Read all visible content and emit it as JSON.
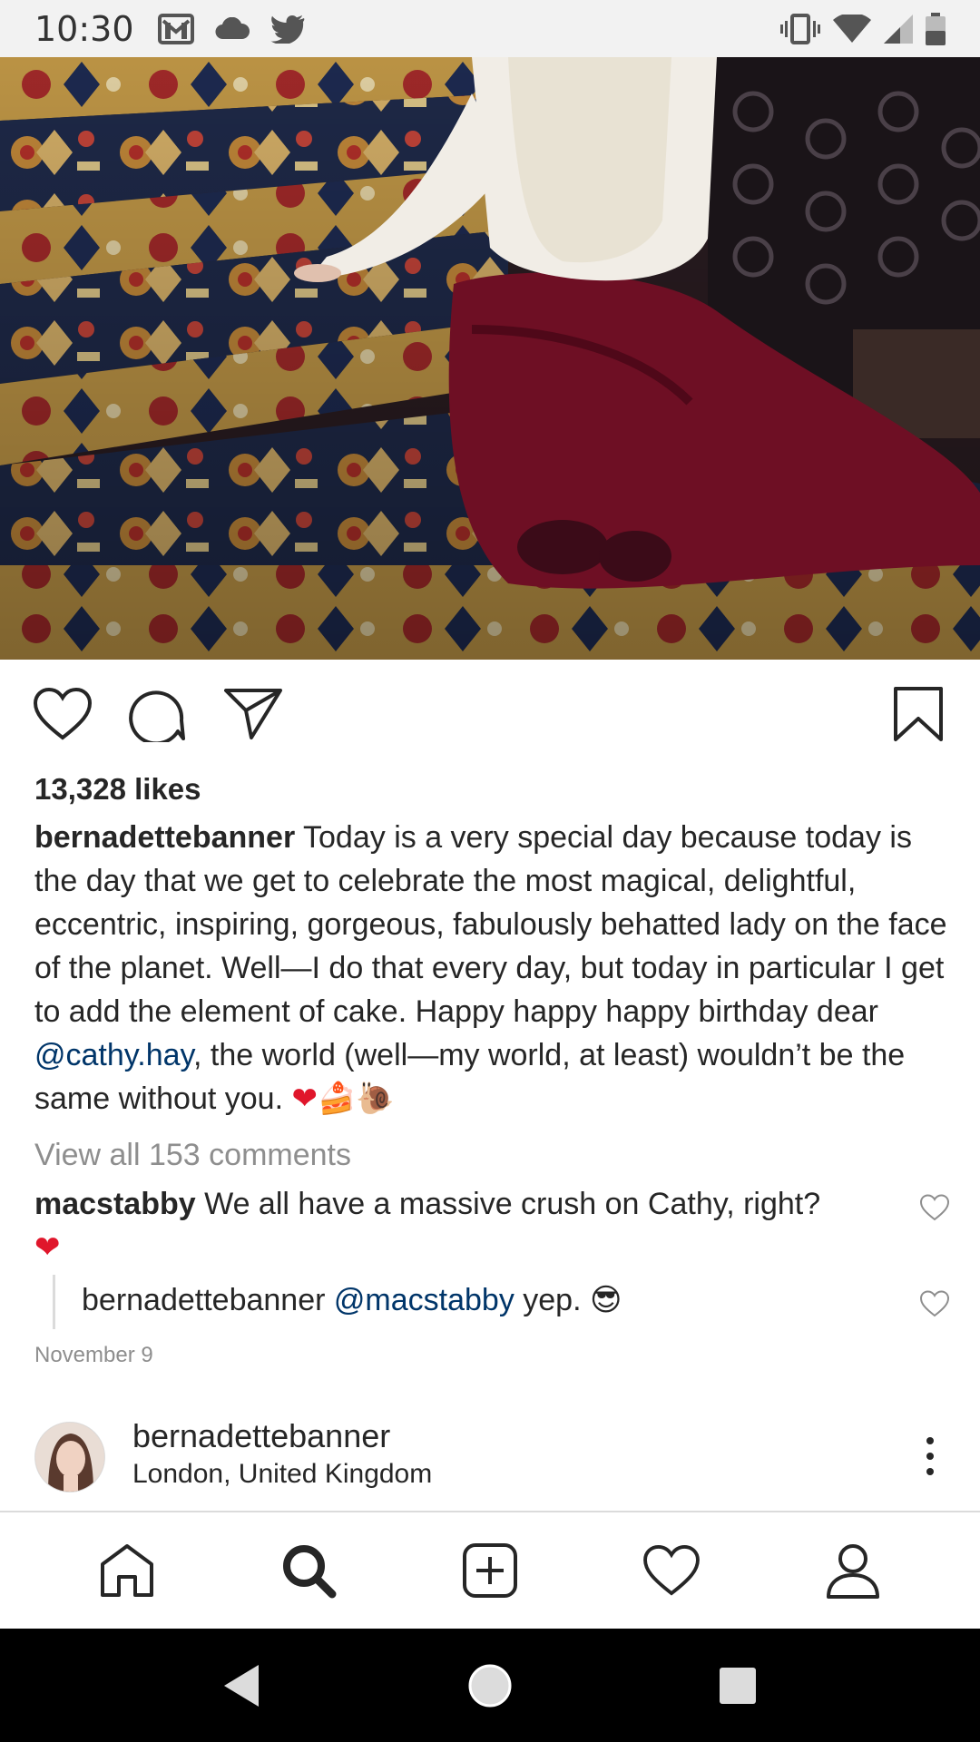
{
  "status_bar": {
    "time": "10:30",
    "icons": [
      "gmail-icon",
      "cloud-icon",
      "twitter-icon",
      "vibrate-icon",
      "wifi-icon",
      "signal-icon",
      "battery-icon"
    ]
  },
  "post": {
    "likes": "13,328 likes",
    "caption": {
      "username": "bernadettebanner",
      "text_before_mention": " Today is a very special day because today is the day that we get to celebrate the most magical, delightful, eccentric, inspiring, gorgeous, fabulously behatted lady on the face of the planet. Well—I do that every day, but today in particular I get to add the element of cake. Happy happy happy birthday dear ",
      "mention": "@cathy.hay",
      "text_after_mention": ", the world (well—my world, at least) wouldn’t be the same without you. ",
      "emojis": [
        "❤",
        "🍰",
        "🐌"
      ]
    },
    "view_comments": "View all 153 comments",
    "comments": [
      {
        "username": "macstabby",
        "text": " We all have a massive crush on Cathy, right?",
        "emoji": "❤"
      }
    ],
    "reply": {
      "username": "bernadettebanner",
      "mention": "@macstabby",
      "text": " yep. ",
      "emoji": "😎"
    },
    "date": "November 9"
  },
  "next_post": {
    "username": "bernadettebanner",
    "location": "London, United Kingdom"
  },
  "bottom_nav": [
    "home-icon",
    "search-icon",
    "add-post-icon",
    "activity-heart-icon",
    "profile-icon"
  ],
  "android_nav": [
    "back-icon",
    "home-circle-icon",
    "recents-icon"
  ],
  "colors": {
    "text": "#262626",
    "mention": "#003569",
    "muted": "#8e8e8e",
    "heart": "#e0162b"
  }
}
